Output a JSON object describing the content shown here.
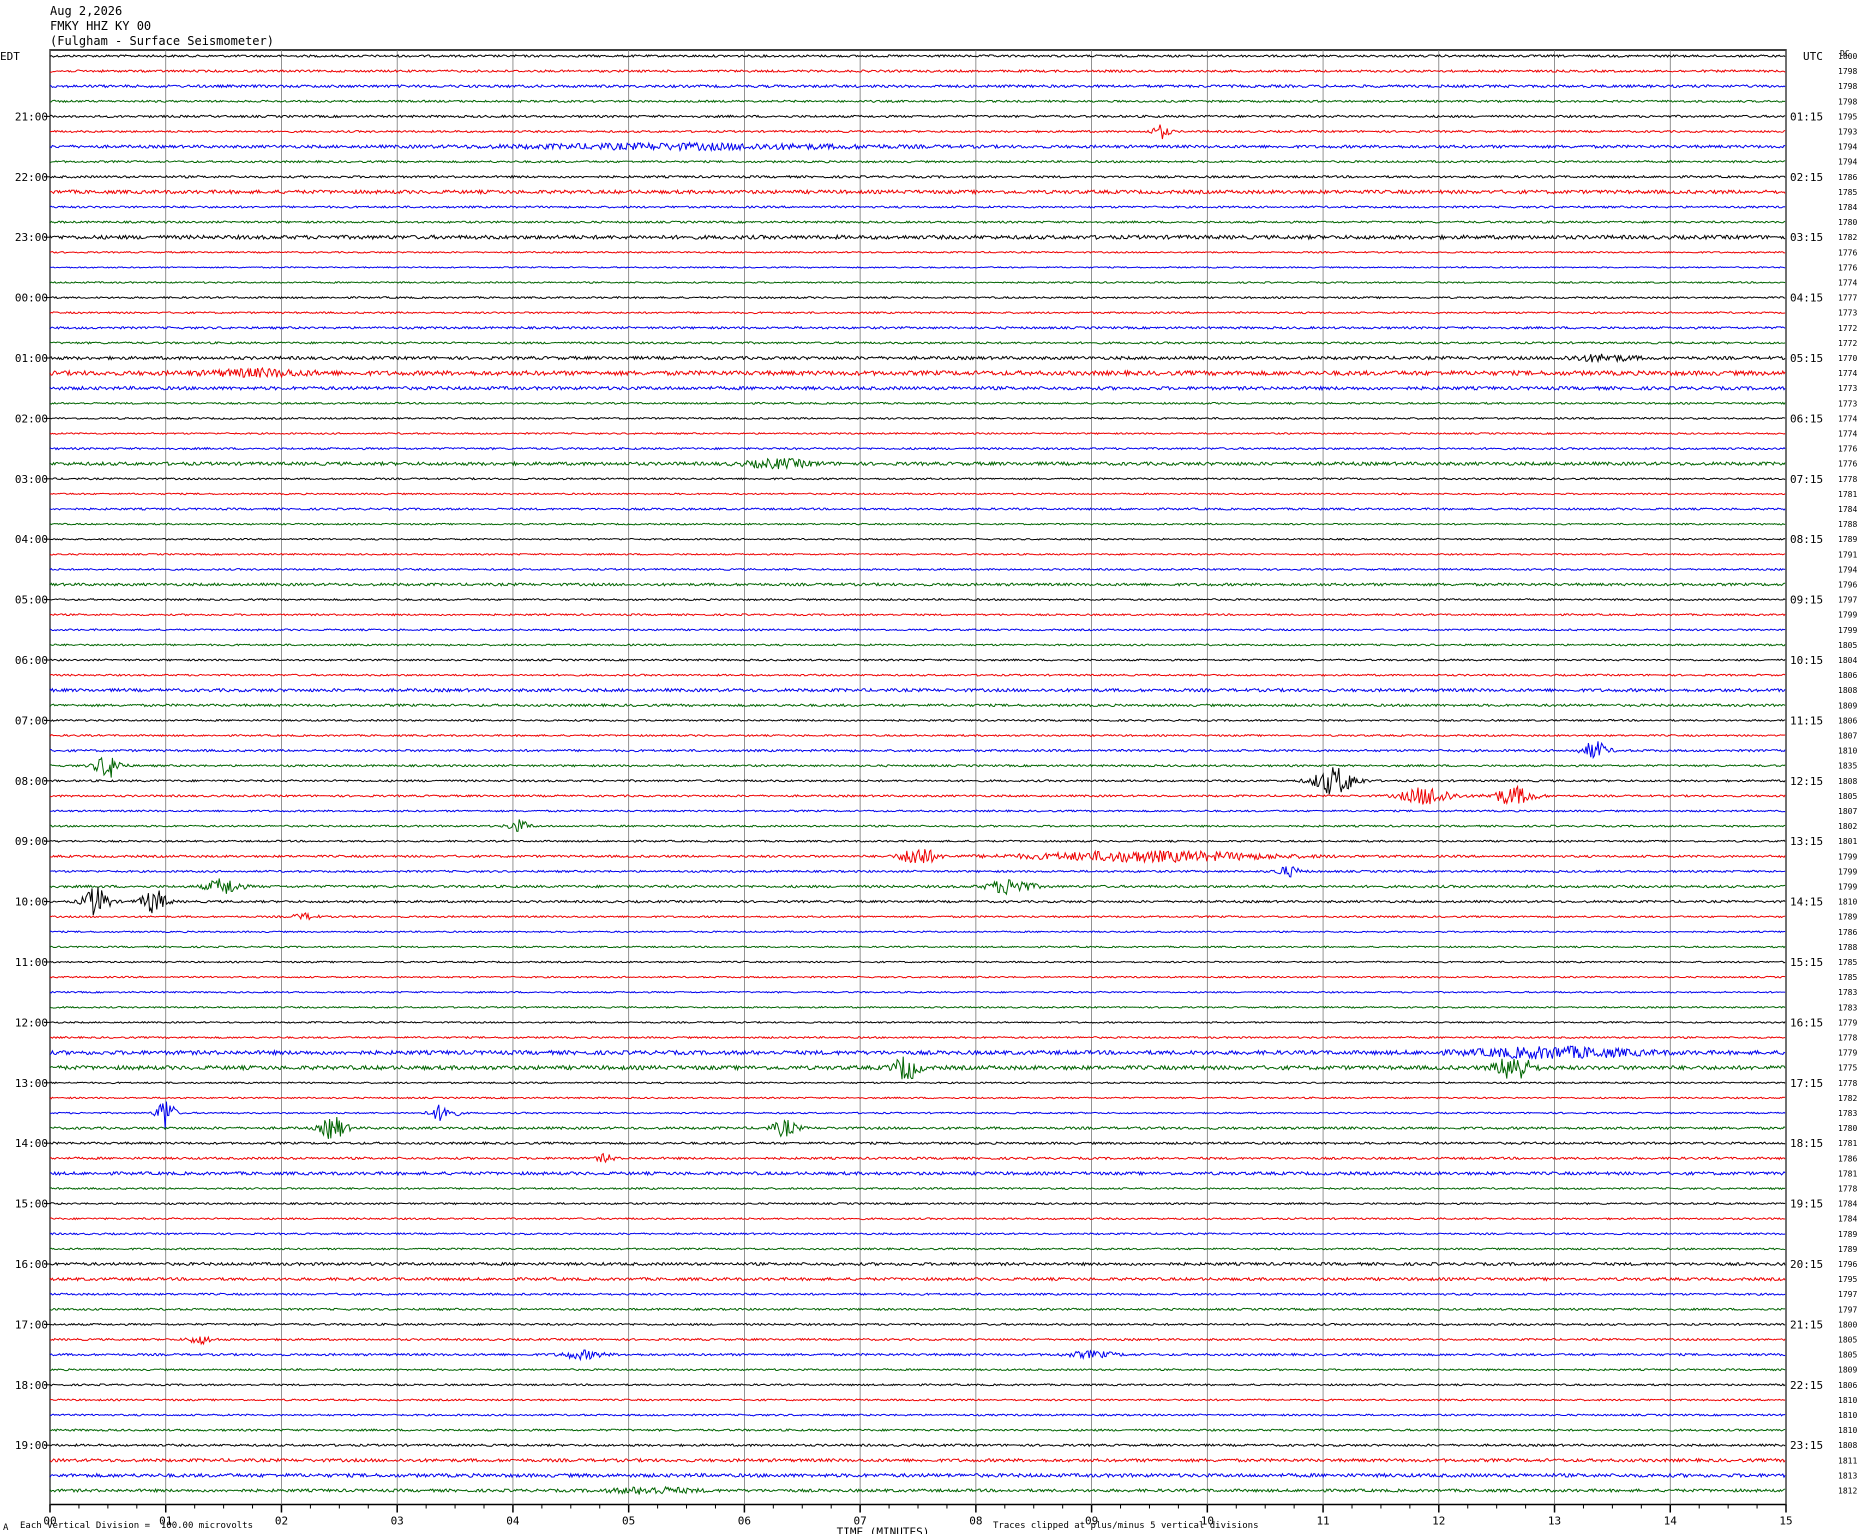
{
  "header": {
    "date": "Aug 2,2026",
    "station": "FMKY HHZ KY 00",
    "location": "(Fulgham - Surface Seismometer)"
  },
  "footer": {
    "corner_mark": "A",
    "scale_note": "Each Vertical Division =  100.00 microvolts",
    "clip_note": "Traces clipped at plus/minus 5 vertical divisions"
  },
  "chart_data": {
    "type": "line",
    "title": "FMKY HHZ KY 00",
    "xlabel": "TIME (MINUTES)",
    "xlim": [
      0,
      15
    ],
    "x_ticks": [
      "00",
      "01",
      "02",
      "03",
      "04",
      "05",
      "06",
      "07",
      "08",
      "09",
      "10",
      "11",
      "12",
      "13",
      "14",
      "15"
    ],
    "left_axis_label": "EDT",
    "right_axis_label": "UTC",
    "right_col_header": "DC",
    "trace_colors": [
      "#000000",
      "#ee0000",
      "#0000ee",
      "#006400"
    ],
    "left_hour_labels": [
      "21:00",
      "22:00",
      "23:00",
      "00:00",
      "01:00",
      "02:00",
      "03:00",
      "04:00",
      "05:00",
      "06:00",
      "07:00",
      "08:00",
      "09:00",
      "10:00",
      "11:00",
      "12:00",
      "13:00",
      "14:00",
      "15:00",
      "16:00",
      "17:00",
      "18:00",
      "19:00"
    ],
    "right_hour_labels": [
      "01:15",
      "02:15",
      "03:15",
      "04:15",
      "05:15",
      "06:15",
      "07:15",
      "08:15",
      "09:15",
      "10:15",
      "11:15",
      "12:15",
      "13:15",
      "14:15",
      "15:15",
      "16:15",
      "17:15",
      "18:15",
      "19:15",
      "20:15",
      "21:15",
      "22:15",
      "23:15"
    ],
    "dc_offsets": [
      "1800",
      "1798",
      "1798",
      "1798",
      "1795",
      "1793",
      "1794",
      "1794",
      "1786",
      "1785",
      "1784",
      "1780",
      "1782",
      "1776",
      "1776",
      "1774",
      "1777",
      "1773",
      "1772",
      "1772",
      "1770",
      "1774",
      "1773",
      "1773",
      "1774",
      "1774",
      "1776",
      "1776",
      "1778",
      "1781",
      "1784",
      "1788",
      "1789",
      "1791",
      "1794",
      "1796",
      "1797",
      "1799",
      "1799",
      "1805",
      "1804",
      "1806",
      "1808",
      "1809",
      "1806",
      "1807",
      "1810",
      "1835",
      "1808",
      "1805",
      "1807",
      "1802",
      "1801",
      "1799",
      "1799",
      "1799",
      "1810",
      "1789",
      "1786",
      "1788",
      "1785",
      "1785",
      "1783",
      "1783",
      "1779",
      "1778",
      "1779",
      "1775",
      "1778",
      "1782",
      "1783",
      "1780",
      "1781",
      "1786",
      "1781",
      "1778",
      "1784",
      "1784",
      "1789",
      "1789",
      "1796",
      "1795",
      "1797",
      "1797",
      "1800",
      "1805",
      "1805",
      "1809",
      "1806",
      "1810",
      "1810",
      "1810",
      "1808",
      "1811",
      "1813",
      "1812"
    ],
    "noise_levels": [
      1.0,
      1.0,
      1.2,
      0.9,
      1.0,
      0.9,
      1.3,
      0.9,
      1.0,
      1.6,
      0.9,
      0.9,
      1.7,
      0.7,
      0.6,
      0.7,
      0.8,
      0.8,
      1.0,
      0.9,
      1.4,
      2.0,
      1.5,
      0.8,
      0.8,
      0.7,
      0.9,
      1.5,
      0.8,
      0.7,
      0.9,
      0.7,
      0.7,
      0.7,
      0.8,
      1.2,
      0.8,
      0.8,
      0.8,
      0.8,
      0.8,
      0.8,
      1.4,
      1.1,
      0.8,
      0.8,
      1.0,
      0.9,
      0.9,
      0.9,
      0.8,
      0.8,
      0.8,
      1.0,
      0.9,
      1.1,
      1.0,
      0.8,
      0.7,
      0.7,
      0.7,
      0.7,
      0.7,
      0.7,
      0.7,
      0.8,
      1.8,
      1.8,
      0.7,
      0.7,
      0.7,
      1.1,
      1.0,
      1.0,
      1.4,
      0.8,
      0.8,
      0.8,
      0.8,
      0.8,
      1.3,
      1.3,
      0.9,
      0.9,
      0.9,
      0.9,
      1.0,
      0.8,
      0.8,
      0.8,
      0.8,
      0.9,
      1.0,
      1.4,
      1.6,
      1.3
    ],
    "events": [
      {
        "trace": 5,
        "minute": 9.6,
        "amp": 7,
        "dur": 0.2
      },
      {
        "trace": 6,
        "minute": 5.5,
        "amp": 2.5,
        "dur": 4.5
      },
      {
        "trace": 21,
        "minute": 1.8,
        "amp": 3,
        "dur": 1.2
      },
      {
        "trace": 20,
        "minute": 13.4,
        "amp": 3,
        "dur": 0.8
      },
      {
        "trace": 27,
        "minute": 6.3,
        "amp": 4,
        "dur": 0.8
      },
      {
        "trace": 47,
        "minute": 0.5,
        "amp": 12,
        "dur": 0.3
      },
      {
        "trace": 46,
        "minute": 13.35,
        "amp": 9,
        "dur": 0.3
      },
      {
        "trace": 48,
        "minute": 11.1,
        "amp": 14,
        "dur": 0.5
      },
      {
        "trace": 49,
        "minute": 11.9,
        "amp": 9,
        "dur": 0.6
      },
      {
        "trace": 49,
        "minute": 12.65,
        "amp": 9,
        "dur": 0.5
      },
      {
        "trace": 51,
        "minute": 4.05,
        "amp": 6,
        "dur": 0.25
      },
      {
        "trace": 53,
        "minute": 7.5,
        "amp": 10,
        "dur": 0.4
      },
      {
        "trace": 53,
        "minute": 9.5,
        "amp": 5,
        "dur": 3.0
      },
      {
        "trace": 54,
        "minute": 10.7,
        "amp": 5,
        "dur": 0.3
      },
      {
        "trace": 55,
        "minute": 1.5,
        "amp": 8,
        "dur": 0.4
      },
      {
        "trace": 55,
        "minute": 8.3,
        "amp": 8,
        "dur": 0.5
      },
      {
        "trace": 56,
        "minute": 0.4,
        "amp": 15,
        "dur": 0.3
      },
      {
        "trace": 56,
        "minute": 0.9,
        "amp": 12,
        "dur": 0.3
      },
      {
        "trace": 57,
        "minute": 2.2,
        "amp": 3,
        "dur": 0.3
      },
      {
        "trace": 66,
        "minute": 13.0,
        "amp": 5,
        "dur": 2.0
      },
      {
        "trace": 67,
        "minute": 7.4,
        "amp": 12,
        "dur": 0.3
      },
      {
        "trace": 67,
        "minute": 12.65,
        "amp": 14,
        "dur": 0.4
      },
      {
        "trace": 70,
        "minute": 1.0,
        "amp": 18,
        "dur": 0.2
      },
      {
        "trace": 70,
        "minute": 3.4,
        "amp": 9,
        "dur": 0.3
      },
      {
        "trace": 71,
        "minute": 2.45,
        "amp": 12,
        "dur": 0.3
      },
      {
        "trace": 71,
        "minute": 6.35,
        "amp": 8,
        "dur": 0.3
      },
      {
        "trace": 73,
        "minute": 4.8,
        "amp": 4,
        "dur": 0.2
      },
      {
        "trace": 85,
        "minute": 1.3,
        "amp": 4,
        "dur": 0.3
      },
      {
        "trace": 86,
        "minute": 4.6,
        "amp": 4,
        "dur": 0.5
      },
      {
        "trace": 86,
        "minute": 9.0,
        "amp": 3,
        "dur": 0.6
      },
      {
        "trace": 95,
        "minute": 5.2,
        "amp": 3,
        "dur": 1.0
      }
    ]
  }
}
